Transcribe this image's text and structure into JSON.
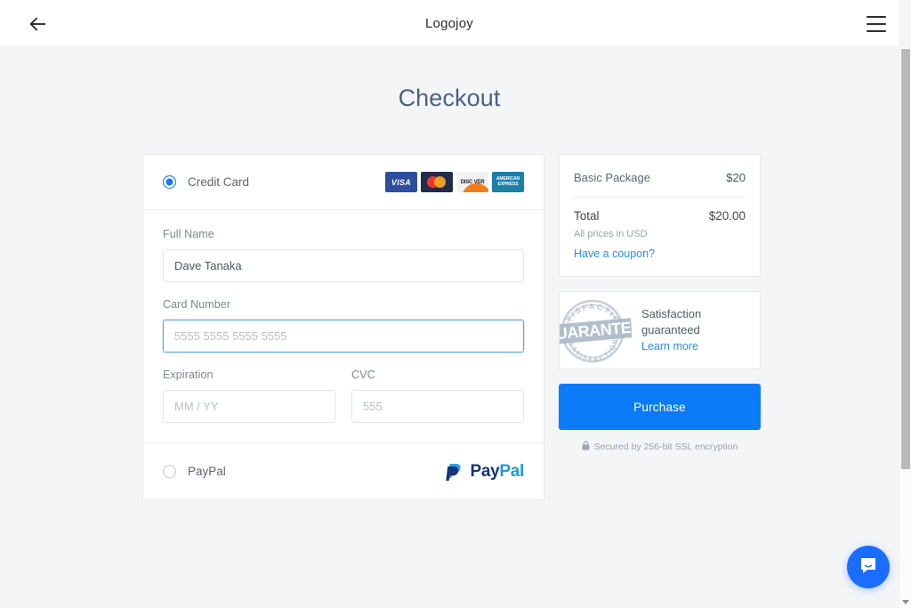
{
  "header": {
    "back_icon": "arrow-left-icon",
    "brand": "Logojoy",
    "menu_icon": "hamburger-menu-icon"
  },
  "page": {
    "title": "Checkout"
  },
  "payment": {
    "credit_card": {
      "label": "Credit Card",
      "selected": true,
      "logos": [
        {
          "name": "visa-logo",
          "text": "VISA"
        },
        {
          "name": "mastercard-logo",
          "text": ""
        },
        {
          "name": "discover-logo",
          "text": "DISC VER"
        },
        {
          "name": "amex-logo",
          "line1": "AMERICAN",
          "line2": "EXPRESS"
        }
      ]
    },
    "fields": {
      "full_name": {
        "label": "Full Name",
        "value": "Dave Tanaka",
        "placeholder": "Full Name"
      },
      "card_number": {
        "label": "Card Number",
        "value": "",
        "placeholder": "5555 5555 5555 5555",
        "focused": true
      },
      "expiration": {
        "label": "Expiration",
        "value": "",
        "placeholder": "MM / YY"
      },
      "cvc": {
        "label": "CVC",
        "value": "",
        "placeholder": "555"
      }
    },
    "paypal": {
      "label": "PayPal",
      "selected": false,
      "logo_pay": "Pay",
      "logo_pal": "Pal"
    }
  },
  "summary": {
    "item_name": "Basic Package",
    "item_price": "$20",
    "total_label": "Total",
    "total_value": "$20.00",
    "currency_note": "All prices in USD",
    "coupon_link": "Have a coupon?"
  },
  "guarantee": {
    "stamp_arc_top": "SATISFACTION",
    "stamp_arc_bottom": "SATISFACTION",
    "stamp_banner": "GUARANTEE",
    "line1": "Satisfaction",
    "line2": "guaranteed",
    "link": "Learn more"
  },
  "purchase": {
    "button_label": "Purchase",
    "ssl_note": "Secured by 256-bit SSL encryption",
    "lock_icon": "lock-icon"
  },
  "chat": {
    "icon": "chat-bubble-icon"
  },
  "colors": {
    "accent_blue": "#0b7bf7",
    "link_blue": "#2e8af6",
    "title_slate": "#4a6285",
    "page_bg": "#f4f5f7"
  }
}
